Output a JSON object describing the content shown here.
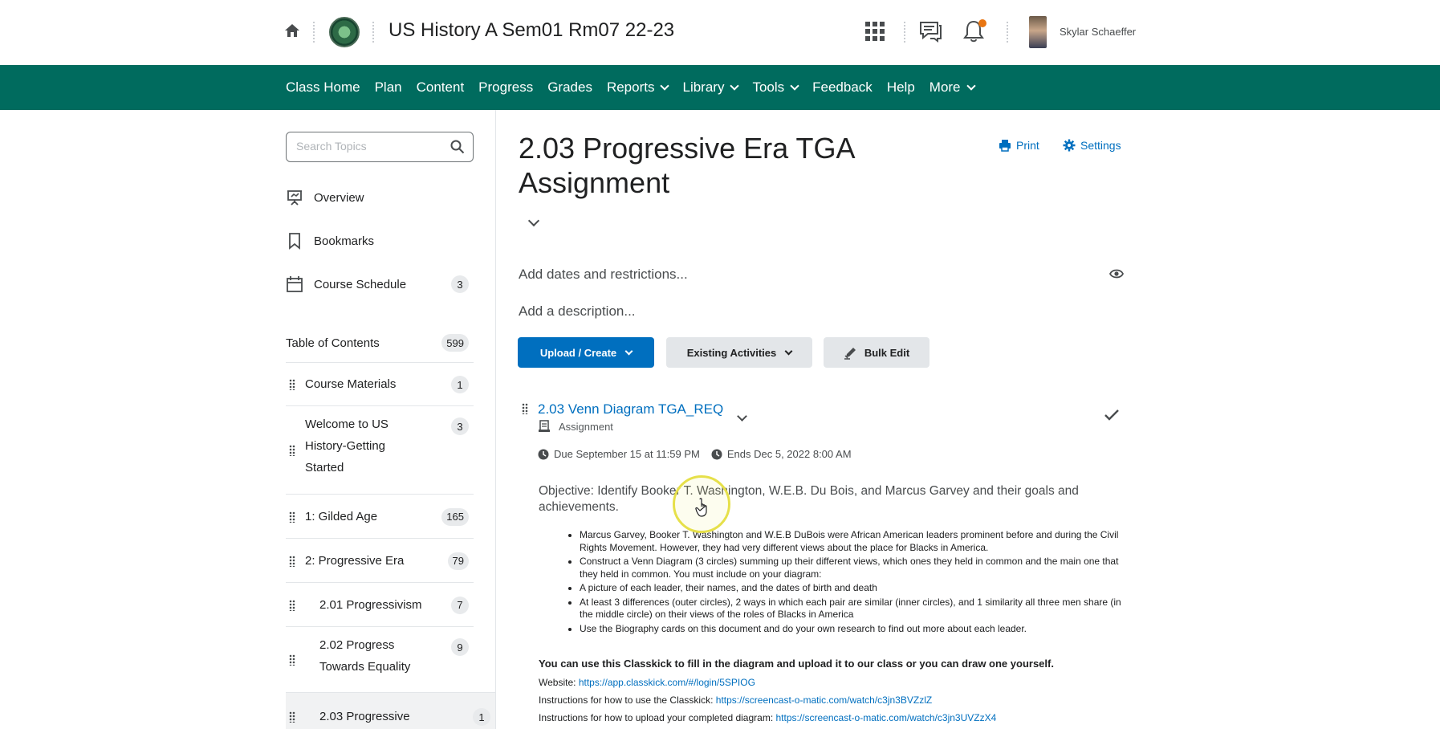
{
  "header": {
    "course_title": "US History A Sem01 Rm07 22-23",
    "user_name": "Skylar Schaeffer",
    "icons": [
      "home-icon",
      "school-logo",
      "apps-grid-icon",
      "message-icon",
      "bell-icon"
    ],
    "notification_dot_color": "#e87511"
  },
  "navbar": {
    "color": "#006b5e",
    "items": [
      {
        "label": "Class Home",
        "dropdown": false
      },
      {
        "label": "Plan",
        "dropdown": false
      },
      {
        "label": "Content",
        "dropdown": false
      },
      {
        "label": "Progress",
        "dropdown": false
      },
      {
        "label": "Grades",
        "dropdown": false
      },
      {
        "label": "Reports",
        "dropdown": true
      },
      {
        "label": "Library",
        "dropdown": true
      },
      {
        "label": "Tools",
        "dropdown": true
      },
      {
        "label": "Feedback",
        "dropdown": false
      },
      {
        "label": "Help",
        "dropdown": false
      },
      {
        "label": "More",
        "dropdown": true
      }
    ]
  },
  "sidebar": {
    "search_placeholder": "Search Topics",
    "links": {
      "overview": "Overview",
      "bookmarks": "Bookmarks",
      "schedule": "Course Schedule",
      "schedule_count": "3"
    },
    "toc_label": "Table of Contents",
    "toc_count": "599",
    "toc_items": [
      {
        "label": "Course Materials",
        "count": "1"
      },
      {
        "label": "Welcome to US\nHistory-Getting\nStarted",
        "count": "3"
      },
      {
        "label": "1: Gilded Age",
        "count": "165"
      },
      {
        "label": "2: Progressive Era",
        "count": "79"
      },
      {
        "label": "2.01 Progressivism",
        "count": "7"
      },
      {
        "label": "2.02 Progress\nTowards Equality",
        "count": "9"
      },
      {
        "label": "2.03 Progressive",
        "count": "1"
      }
    ]
  },
  "main": {
    "title": "2.03 Progressive Era TGA Assignment",
    "print_label": "Print",
    "settings_label": "Settings",
    "add_dates": "Add dates and restrictions...",
    "add_description": "Add a description...",
    "buttons": {
      "upload": "Upload / Create",
      "existing": "Existing Activities",
      "bulk": "Bulk Edit"
    },
    "item": {
      "title": "2.03 Venn Diagram TGA_REQ",
      "type": "Assignment",
      "due": "Due September 15 at 11:59 PM",
      "ends": "Ends Dec 5, 2022 8:00 AM",
      "objective": "Objective: Identify Booker T. Washington, W.E.B. Du Bois, and Marcus Garvey and their goals and achievements.",
      "bullets": [
        "Marcus Garvey, Booker T. Washington and W.E.B DuBois were African American leaders prominent before and during the Civil Rights Movement. However, they had very different views about the place for Blacks in America.",
        "Construct a Venn Diagram (3 circles) summing up their different views, which ones they held in common and the main one that they held in common. You must include on your diagram:",
        "A picture of each leader, their names, and the dates of birth and death",
        "At least 3 differences (outer circles), 2 ways in which each pair are similar (inner circles), and 1 similarity all three men share (in the middle circle) on their views of the roles of Blacks in America",
        "Use the Biography cards on this document and do your own research to find out more about each leader."
      ],
      "classkick_text": "You can use this Classkick to fill in the diagram and upload it to our class or you can draw one yourself.",
      "links": [
        {
          "prefix": "Website: ",
          "url": "https://app.classkick.com/#/login/5SPIOG"
        },
        {
          "prefix": "Instructions for how to use the Classkick: ",
          "url": "https://screencast-o-matic.com/watch/c3jn3BVZzlZ"
        },
        {
          "prefix": "Instructions for how to upload your completed diagram: ",
          "url": "https://screencast-o-matic.com/watch/c3jn3UVZzX4"
        }
      ]
    }
  },
  "colors": {
    "accent_blue": "#006fbf",
    "nav_green": "#006b5e",
    "cursor_highlight": "#e6e04a"
  }
}
